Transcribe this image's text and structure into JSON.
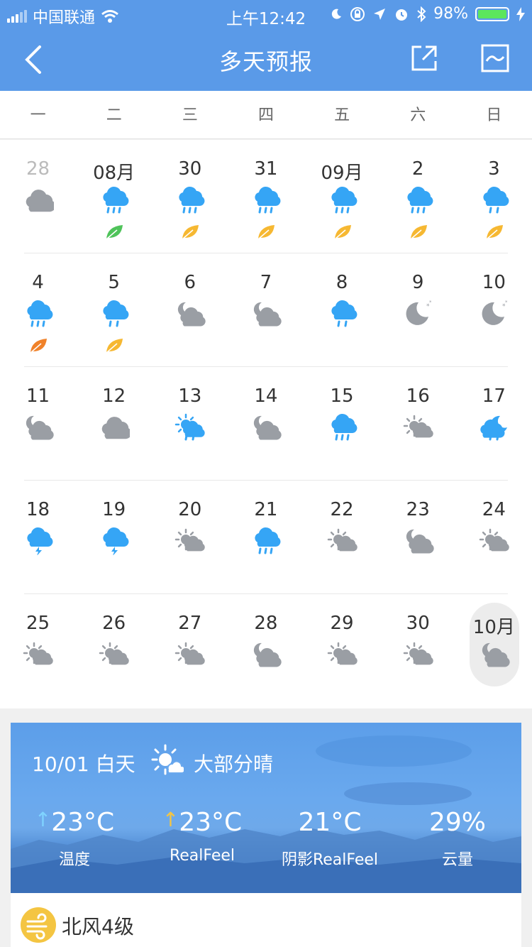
{
  "status_bar": {
    "carrier": "中国联通",
    "time": "上午12:42",
    "battery_percent": "98%"
  },
  "navbar": {
    "title": "多天预报"
  },
  "weekdays": [
    "一",
    "二",
    "三",
    "四",
    "五",
    "六",
    "日"
  ],
  "calendar": {
    "weeks": [
      [
        {
          "label": "28",
          "icon": "cloud-icon",
          "leaf": "",
          "dim": true
        },
        {
          "label": "08月",
          "icon": "rain-icon",
          "leaf": "green-leaf-icon"
        },
        {
          "label": "30",
          "icon": "rain-icon",
          "leaf": "yellow-leaf-icon"
        },
        {
          "label": "31",
          "icon": "rain-icon",
          "leaf": "yellow-leaf-icon"
        },
        {
          "label": "09月",
          "icon": "rain-icon",
          "leaf": "yellow-leaf-icon"
        },
        {
          "label": "2",
          "icon": "rain-icon",
          "leaf": "yellow-leaf-icon"
        },
        {
          "label": "3",
          "icon": "rain-light-icon",
          "leaf": "yellow-leaf-icon"
        }
      ],
      [
        {
          "label": "4",
          "icon": "rain-icon",
          "leaf": "orange-leaf-icon"
        },
        {
          "label": "5",
          "icon": "rain-light-icon",
          "leaf": "yellow-leaf-icon"
        },
        {
          "label": "6",
          "icon": "moon-cloud-icon",
          "leaf": ""
        },
        {
          "label": "7",
          "icon": "moon-cloud-icon",
          "leaf": ""
        },
        {
          "label": "8",
          "icon": "rain-light-icon",
          "leaf": ""
        },
        {
          "label": "9",
          "icon": "moon-icon",
          "leaf": ""
        },
        {
          "label": "10",
          "icon": "moon-icon",
          "leaf": ""
        }
      ],
      [
        {
          "label": "11",
          "icon": "moon-cloud-icon",
          "leaf": ""
        },
        {
          "label": "12",
          "icon": "cloud-icon",
          "leaf": ""
        },
        {
          "label": "13",
          "icon": "sun-rain-icon",
          "leaf": ""
        },
        {
          "label": "14",
          "icon": "moon-cloud-icon",
          "leaf": ""
        },
        {
          "label": "15",
          "icon": "rain-icon",
          "leaf": ""
        },
        {
          "label": "16",
          "icon": "sun-cloud-icon",
          "leaf": ""
        },
        {
          "label": "17",
          "icon": "moon-rain-icon",
          "leaf": ""
        }
      ],
      [
        {
          "label": "18",
          "icon": "thunder-icon",
          "leaf": ""
        },
        {
          "label": "19",
          "icon": "thunder-icon",
          "leaf": ""
        },
        {
          "label": "20",
          "icon": "sun-cloud-icon",
          "leaf": ""
        },
        {
          "label": "21",
          "icon": "rain-icon",
          "leaf": ""
        },
        {
          "label": "22",
          "icon": "sun-cloud-icon",
          "leaf": ""
        },
        {
          "label": "23",
          "icon": "moon-cloud-icon",
          "leaf": ""
        },
        {
          "label": "24",
          "icon": "sun-cloud-icon",
          "leaf": ""
        }
      ],
      [
        {
          "label": "25",
          "icon": "sun-cloud-icon",
          "leaf": ""
        },
        {
          "label": "26",
          "icon": "sun-cloud-icon",
          "leaf": ""
        },
        {
          "label": "27",
          "icon": "sun-cloud-icon",
          "leaf": ""
        },
        {
          "label": "28",
          "icon": "moon-cloud-icon",
          "leaf": ""
        },
        {
          "label": "29",
          "icon": "sun-cloud-icon",
          "leaf": ""
        },
        {
          "label": "30",
          "icon": "sun-cloud-icon",
          "leaf": ""
        },
        {
          "label": "10月",
          "icon": "moon-cloud-icon",
          "leaf": "",
          "selected": true
        }
      ]
    ]
  },
  "detail": {
    "date": "10/01 白天",
    "condition": "大部分晴",
    "condition_icon": "sun-cloud-icon",
    "metrics": [
      {
        "value": "23°C",
        "label": "温度",
        "arrow": "↑",
        "arrow_color": "#7fd3ff"
      },
      {
        "value": "23°C",
        "label": "RealFeel",
        "arrow": "↑",
        "arrow_color": "#f4c542"
      },
      {
        "value": "21°C",
        "label": "阴影RealFeel",
        "arrow": ""
      },
      {
        "value": "29%",
        "label": "云量",
        "arrow": ""
      }
    ]
  },
  "wind": {
    "text": "北风4级",
    "icon": "wind-icon"
  },
  "colors": {
    "accent": "#5a9ae8",
    "rain_blue": "#35a5f5",
    "cloud_gray": "#9a9ea4"
  }
}
